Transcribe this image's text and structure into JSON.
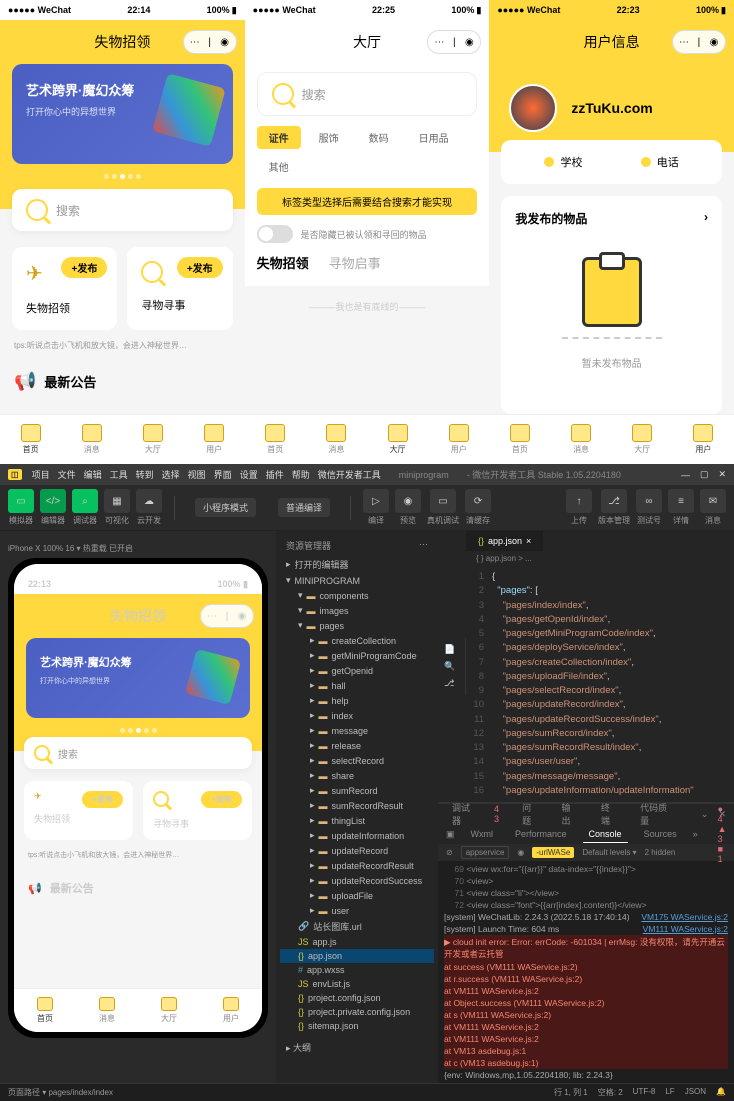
{
  "phone1": {
    "status": {
      "carrier": "●●●●● WeChat",
      "time": "22:14",
      "battery": "100%"
    },
    "title": "失物招领",
    "banner": {
      "title": "艺术跨界·魔幻众筹",
      "sub": "打开你心中的异想世界"
    },
    "search": "搜索",
    "pub_btn": "+发布",
    "pub1": "失物招领",
    "pub2": "寻物寻事",
    "tips": "tps:听说点击小飞机和放大镜，会进入神秘世界…",
    "announce": "最新公告",
    "tabs": [
      "首页",
      "消息",
      "大厅",
      "用户"
    ]
  },
  "phone2": {
    "status": {
      "carrier": "●●●●● WeChat",
      "time": "22:25",
      "battery": "100%"
    },
    "title": "大厅",
    "search": "搜索",
    "chips": [
      "证件",
      "服饰",
      "数码",
      "日用品",
      "其他"
    ],
    "hint": "标签类型选择后需要结合搜索才能实现",
    "toggle_label": "是否隐藏已被认领和寻回的物品",
    "seg": [
      "失物招领",
      "寻物启事"
    ],
    "footer": "———我也是有底线的———"
  },
  "phone3": {
    "status": {
      "carrier": "●●●●● WeChat",
      "time": "22:23",
      "battery": "100%"
    },
    "title": "用户信息",
    "username": "zzTuKu.com",
    "info_tabs": [
      "学校",
      "电话"
    ],
    "my_items": "我发布的物品",
    "empty": "暂未发布物品"
  },
  "ide": {
    "menu": [
      "项目",
      "文件",
      "编辑",
      "工具",
      "转到",
      "选择",
      "视图",
      "界面",
      "设置",
      "插件",
      "帮助",
      "微信开发者工具"
    ],
    "path": "miniprogram",
    "version": "- 微信开发者工具 Stable 1.05.2204180",
    "toolbar": {
      "sim": "模拟器",
      "editor": "编辑器",
      "debug": "调试器",
      "vis": "可视化",
      "cloud": "云开发",
      "mode": "小程序模式",
      "env": "普通编译",
      "compile": "编译",
      "preview": "预览",
      "real": "真机调试",
      "clear": "清缓存",
      "upload": "上传",
      "vm": "版本管理",
      "test": "测试号",
      "detail": "详情",
      "msg": "消息"
    },
    "sim_header": "iPhone X 100% 16 ▾   热重载 已开启",
    "tree_title": "资源管理器",
    "tree_root_open": "打开的编辑器",
    "tree_root": "MINIPROGRAM",
    "tree": [
      "components",
      "images",
      "pages",
      "createCollection",
      "getMiniProgramCode",
      "getOpenid",
      "hall",
      "help",
      "index",
      "message",
      "release",
      "selectRecord",
      "share",
      "sumRecord",
      "sumRecordResult",
      "thingList",
      "updateInformation",
      "updateRecord",
      "updateRecordResult",
      "updateRecordSuccess",
      "uploadFile",
      "user"
    ],
    "tree_files": [
      "站长图库.url",
      "app.js",
      "app.json",
      "app.wxss",
      "envList.js",
      "project.config.json",
      "project.private.config.json",
      "sitemap.json"
    ],
    "editor_tab": "app.json",
    "breadcrumb": "{ } app.json > ...",
    "code_pages": [
      "pages/index/index",
      "pages/getOpenId/index",
      "pages/getMiniProgramCode/index",
      "pages/deployService/index",
      "pages/createCollection/index",
      "pages/uploadFile/index",
      "pages/selectRecord/index",
      "pages/updateRecord/index",
      "pages/updateRecordSuccess/index",
      "pages/sumRecord/index",
      "pages/sumRecordResult/index",
      "pages/user/user",
      "pages/message/message",
      "pages/updateInformation/updateInformation"
    ],
    "console": {
      "top_tabs": [
        "调试器",
        "4 3",
        "问题",
        "输出",
        "终端",
        "代码质量"
      ],
      "tabs": [
        "Wxml",
        "Performance",
        "Console",
        "Sources"
      ],
      "badges": "● 4 ▲ 3 ■ 1",
      "filter": "appservice",
      "url": "-urlWASe",
      "levels": "Default levels ▾",
      "hidden": "2 hidden",
      "code_lines": [
        {
          "no": "69",
          "t": "  <view wx:for=\"{{arr}}\" data-index=\"{{index}}\">"
        },
        {
          "no": "70",
          "t": "    <view>"
        },
        {
          "no": "71",
          "t": "      <view class=\"li\"></view>"
        },
        {
          "no": "72",
          "t": "      <view class=\"font\">{{arr[index].content}}</view>"
        }
      ],
      "logs": [
        {
          "cls": "sys",
          "t": "[system] WeChatLib: 2.24.3 (2022.5.18 17:40:14)",
          "r": "VM175 WAService.js:2"
        },
        {
          "cls": "sys",
          "t": "[system] Launch Time: 604 ms",
          "r": "VM111 WAService.js:2"
        },
        {
          "cls": "err",
          "t": "▶ cloud init error: Error: errCode: -601034 | errMsg: 没有权限，请先开通云开发或者云托管",
          "r": ""
        },
        {
          "cls": "err",
          "t": "  at success (VM111 WAService.js:2)",
          "r": ""
        },
        {
          "cls": "err",
          "t": "  at r.success (VM111 WAService.js:2)",
          "r": ""
        },
        {
          "cls": "err",
          "t": "  at VM111 WAService.js:2",
          "r": ""
        },
        {
          "cls": "err",
          "t": "  at Object.success (VM111 WAService.js:2)",
          "r": ""
        },
        {
          "cls": "err",
          "t": "  at s (VM111 WAService.js:2)",
          "r": ""
        },
        {
          "cls": "err",
          "t": "  at VM111 WAService.js:2",
          "r": ""
        },
        {
          "cls": "err",
          "t": "  at VM111 WAService.js:2",
          "r": ""
        },
        {
          "cls": "err",
          "t": "  at VM13 asdebug.js:1",
          "r": ""
        },
        {
          "cls": "err",
          "t": "  at c (VM13 asdebug.js:1)",
          "r": ""
        },
        {
          "cls": "sys",
          "t": "{env: Windows,mp,1.05.2204180; lib: 2.24.3}",
          "r": ""
        }
      ]
    },
    "statusbar": {
      "left": "页面路径 ▾  pages/index/index",
      "right": [
        "行 1, 列 1",
        "空格: 2",
        "UTF-8",
        "LF",
        "JSON"
      ]
    }
  }
}
